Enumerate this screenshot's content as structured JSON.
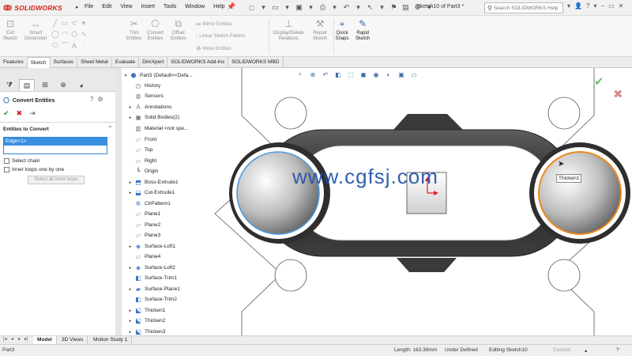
{
  "app": {
    "brand": "SOLIDWORKS",
    "document_title": "Sketch10 of Part3 *",
    "menu": [
      "File",
      "Edit",
      "View",
      "Insert",
      "Tools",
      "Window",
      "Help"
    ],
    "search_placeholder": "Search SOLIDWORKS Help"
  },
  "ribbon": {
    "exit_sketch": "Exit\nSketch",
    "smart_dimension": "Smart\nDimension",
    "trim_entities": "Trim\nEntities",
    "convert_entities": "Convert\nEntities",
    "offset_entities": "Offset\nEntities",
    "mirror_entities": "Mirror Entities",
    "linear_pattern": "Linear Sketch Pattern",
    "move_entities": "Move Entities",
    "display_delete_relations": "Display/Delete\nRelations",
    "repair_sketch": "Repair\nSketch",
    "quick_snaps": "Quick\nSnaps",
    "rapid_sketch": "Rapid\nSketch"
  },
  "tabs": [
    "Features",
    "Sketch",
    "Surfaces",
    "Sheet Metal",
    "Evaluate",
    "DimXpert",
    "SOLIDWORKS Add-Ins",
    "SOLIDWORKS MBD"
  ],
  "active_tab": "Sketch",
  "property_manager": {
    "title": "Convert Entities",
    "section_title": "Entities to Convert",
    "selected_item": "Edge<1>",
    "select_chain": "Select chain",
    "inner_loops": "Inner loops one by one",
    "select_all_inner_loops": "Select all inner loops"
  },
  "tree": {
    "root": "Part3  (Default<<Defa...",
    "items": [
      "History",
      "Sensors",
      "Annotations",
      "Solid Bodies(2)",
      "Material <not spe...",
      "Front",
      "Top",
      "Right",
      "Origin",
      "Boss-Extrude1",
      "Cut-Extrude1",
      "CirPattern1",
      "Plane1",
      "Plane2",
      "Plane3",
      "Surface-Loft1",
      "Plane4",
      "Surface-Loft2",
      "Surface-Trim1",
      "Surface-Plane1",
      "Surface-Trim2",
      "Thicken1",
      "Thicken2",
      "Thicken3"
    ]
  },
  "viewport": {
    "watermark": "www.cgfsj.com",
    "tooltip": "Thicken1"
  },
  "bottom_tabs": [
    "Model",
    "3D Views",
    "Motion Study 1"
  ],
  "status": {
    "part": "Part3",
    "length": "Length: 163.39mm",
    "state": "Under Defined",
    "editing": "Editing Sketch10",
    "units": "Custom"
  },
  "colors": {
    "brand_red": "#d2231a",
    "selection_blue": "#3a8fe0",
    "edge_highlight_orange": "#f08a1c",
    "edge_selected_blue": "#4d9be0"
  }
}
